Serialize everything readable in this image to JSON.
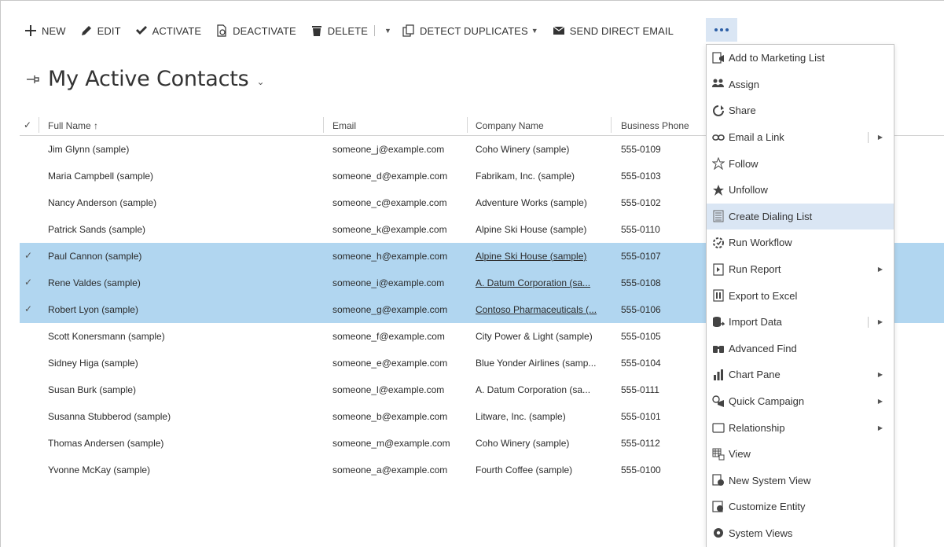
{
  "toolbar": {
    "new": "NEW",
    "edit": "EDIT",
    "activate": "ACTIVATE",
    "deactivate": "DEACTIVATE",
    "delete": "DELETE",
    "detect_duplicates": "DETECT DUPLICATES",
    "send_email": "SEND DIRECT EMAIL"
  },
  "view": {
    "title": "My Active Contacts"
  },
  "grid": {
    "headers": {
      "name": "Full Name ↑",
      "email": "Email",
      "company": "Company Name",
      "phone": "Business Phone"
    },
    "rows": [
      {
        "selected": false,
        "name": "Jim Glynn (sample)",
        "email": "someone_j@example.com",
        "company": "Coho Winery (sample)",
        "phone": "555-0109"
      },
      {
        "selected": false,
        "name": "Maria Campbell (sample)",
        "email": "someone_d@example.com",
        "company": "Fabrikam, Inc. (sample)",
        "phone": "555-0103"
      },
      {
        "selected": false,
        "name": "Nancy Anderson (sample)",
        "email": "someone_c@example.com",
        "company": "Adventure Works (sample)",
        "phone": "555-0102"
      },
      {
        "selected": false,
        "name": "Patrick Sands (sample)",
        "email": "someone_k@example.com",
        "company": "Alpine Ski House (sample)",
        "phone": "555-0110"
      },
      {
        "selected": true,
        "name": "Paul Cannon (sample)",
        "email": "someone_h@example.com",
        "company": "Alpine Ski House (sample)",
        "phone": "555-0107"
      },
      {
        "selected": true,
        "name": "Rene Valdes (sample)",
        "email": "someone_i@example.com",
        "company": "A. Datum Corporation (sa...",
        "phone": "555-0108"
      },
      {
        "selected": true,
        "name": "Robert Lyon (sample)",
        "email": "someone_g@example.com",
        "company": "Contoso Pharmaceuticals (...",
        "phone": "555-0106"
      },
      {
        "selected": false,
        "name": "Scott Konersmann (sample)",
        "email": "someone_f@example.com",
        "company": "City Power & Light (sample)",
        "phone": "555-0105"
      },
      {
        "selected": false,
        "name": "Sidney Higa (sample)",
        "email": "someone_e@example.com",
        "company": "Blue Yonder Airlines (samp...",
        "phone": "555-0104"
      },
      {
        "selected": false,
        "name": "Susan Burk (sample)",
        "email": "someone_l@example.com",
        "company": "A. Datum Corporation (sa...",
        "phone": "555-0111"
      },
      {
        "selected": false,
        "name": "Susanna Stubberod (sample)",
        "email": "someone_b@example.com",
        "company": "Litware, Inc. (sample)",
        "phone": "555-0101"
      },
      {
        "selected": false,
        "name": "Thomas Andersen (sample)",
        "email": "someone_m@example.com",
        "company": "Coho Winery (sample)",
        "phone": "555-0112"
      },
      {
        "selected": false,
        "name": "Yvonne McKay (sample)",
        "email": "someone_a@example.com",
        "company": "Fourth Coffee (sample)",
        "phone": "555-0100"
      }
    ]
  },
  "menu": {
    "items": [
      {
        "label": "Add to Marketing List",
        "icon": "marketing-list-icon",
        "submenu": false,
        "highlighted": false
      },
      {
        "label": "Assign",
        "icon": "assign-icon",
        "submenu": false,
        "highlighted": false
      },
      {
        "label": "Share",
        "icon": "share-icon",
        "submenu": false,
        "highlighted": false
      },
      {
        "label": "Email a Link",
        "icon": "link-icon",
        "submenu": true,
        "split": true,
        "highlighted": false
      },
      {
        "label": "Follow",
        "icon": "star-outline-icon",
        "submenu": false,
        "highlighted": false
      },
      {
        "label": "Unfollow",
        "icon": "star-filled-icon",
        "submenu": false,
        "highlighted": false
      },
      {
        "label": "Create Dialing List",
        "icon": "dialing-list-icon",
        "submenu": false,
        "highlighted": true
      },
      {
        "label": "Run Workflow",
        "icon": "workflow-icon",
        "submenu": false,
        "highlighted": false
      },
      {
        "label": "Run Report",
        "icon": "report-icon",
        "submenu": true,
        "split": false,
        "highlighted": false
      },
      {
        "label": "Export to Excel",
        "icon": "excel-icon",
        "submenu": false,
        "highlighted": false
      },
      {
        "label": "Import Data",
        "icon": "import-icon",
        "submenu": true,
        "split": true,
        "highlighted": false
      },
      {
        "label": "Advanced Find",
        "icon": "binoculars-icon",
        "submenu": false,
        "highlighted": false
      },
      {
        "label": "Chart Pane",
        "icon": "chart-icon",
        "submenu": true,
        "split": false,
        "highlighted": false
      },
      {
        "label": "Quick Campaign",
        "icon": "campaign-icon",
        "submenu": true,
        "split": false,
        "highlighted": false
      },
      {
        "label": "Relationship",
        "icon": "relationship-icon",
        "submenu": true,
        "split": false,
        "highlighted": false
      },
      {
        "label": "View",
        "icon": "view-icon",
        "submenu": false,
        "highlighted": false
      },
      {
        "label": "New System View",
        "icon": "new-view-icon",
        "submenu": false,
        "highlighted": false
      },
      {
        "label": "Customize Entity",
        "icon": "customize-icon",
        "submenu": false,
        "highlighted": false
      },
      {
        "label": "System Views",
        "icon": "gear-icon",
        "submenu": false,
        "highlighted": false
      }
    ]
  },
  "colors": {
    "selected_row": "#b1d6f0",
    "menu_highlight": "#dae6f4",
    "accent": "#2d5fa6"
  }
}
